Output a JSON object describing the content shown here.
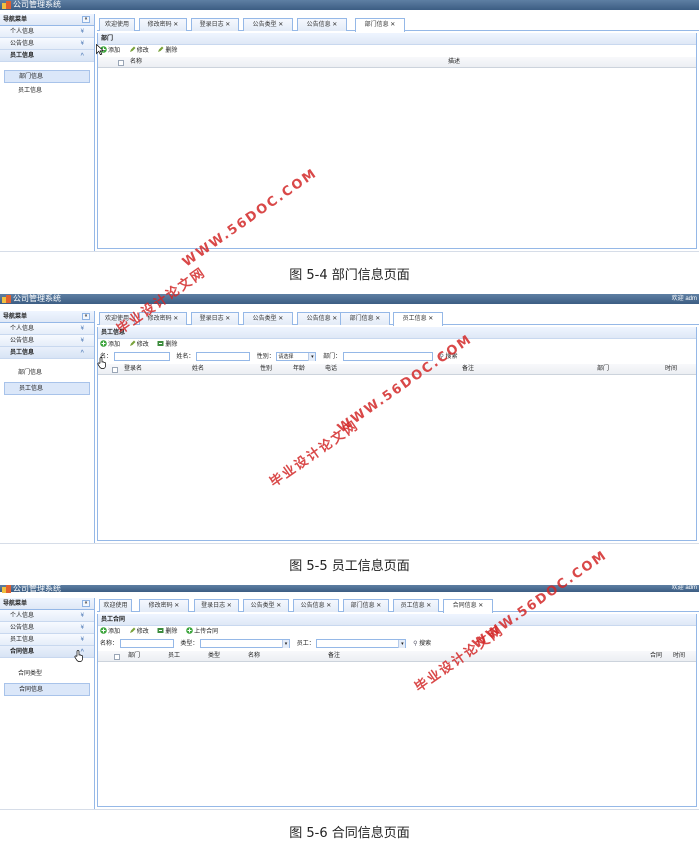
{
  "app_title": "公司管理系统",
  "welcome": "欢迎 adm",
  "screens": [
    {
      "sidebar": {
        "header": "导航菜单",
        "panels": [
          "个人信息",
          "公告信息",
          "员工信息"
        ],
        "items": [
          "部门信息",
          "员工信息"
        ]
      },
      "tabs": [
        "欢迎使用",
        "修改密码 ✕",
        "登录日志 ✕",
        "公告类型 ✕",
        "公告信息 ✕",
        "部门信息 ✕"
      ],
      "content_title": "部门",
      "toolbar": [
        "添加",
        "修改",
        "删除"
      ],
      "columns": [
        "名称",
        "描述"
      ],
      "caption": "图 5-4 部门信息页面"
    },
    {
      "sidebar": {
        "header": "导航菜单",
        "panels": [
          "个人信息",
          "公告信息",
          "员工信息"
        ],
        "items": [
          "部门信息",
          "员工信息"
        ]
      },
      "tabs": [
        "欢迎使用",
        "修改密码 ✕",
        "登录日志 ✕",
        "公告类型 ✕",
        "公告信息 ✕",
        "部门信息 ✕",
        "员工信息 ✕"
      ],
      "content_title": "员工信息",
      "toolbar": [
        "添加",
        "修改",
        "删除"
      ],
      "filters": {
        "name_label": "名：",
        "realname_label": "姓名：",
        "gender_label": "性别：",
        "gender_value": "请选择",
        "dept_label": "部门：",
        "search": "搜索"
      },
      "columns": [
        "登录名",
        "姓名",
        "性别",
        "年龄",
        "电话",
        "备注",
        "部门",
        "时间"
      ],
      "caption": "图 5-5 员工信息页面"
    },
    {
      "sidebar": {
        "header": "导航菜单",
        "panels": [
          "个人信息",
          "公告信息",
          "员工信息",
          "合同信息"
        ],
        "items": [
          "合同类型",
          "合同信息"
        ]
      },
      "tabs": [
        "欢迎使用",
        "修改密码 ✕",
        "登录日志 ✕",
        "公告类型 ✕",
        "公告信息 ✕",
        "部门信息 ✕",
        "员工信息 ✕",
        "合同信息 ✕"
      ],
      "content_title": "员工合同",
      "toolbar": [
        "添加",
        "修改",
        "删除",
        "上传合同"
      ],
      "filters": {
        "name_label": "名称：",
        "type_label": "类型：",
        "emp_label": "员工：",
        "search": "搜索"
      },
      "columns": [
        "部门",
        "员工",
        "类型",
        "名称",
        "备注",
        "合同",
        "时间"
      ],
      "caption": "图 5-6 合同信息页面"
    }
  ],
  "watermarks": {
    "url": "WWW.56DOC.COM",
    "cn": "毕业设计论文网"
  },
  "colors": {
    "titlebar": "#4a6d93",
    "border": "#95b8e7",
    "watermark": "#d22828"
  }
}
